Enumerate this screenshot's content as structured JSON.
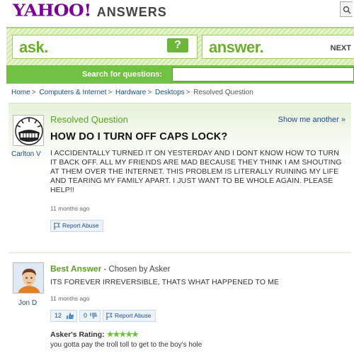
{
  "header": {
    "logo_yahoo": "YAHOO!",
    "logo_answers": "ANSWERS"
  },
  "band": {
    "ask_label": "ask.",
    "ask_button": "?",
    "answer_label": "answer.",
    "next_label": "NEXT",
    "search_label": "Search for questions:",
    "search_value": ""
  },
  "breadcrumb": {
    "items": [
      "Home",
      "Computers & Internet",
      "Hardware",
      "Desktops"
    ],
    "current": "Resolved Question",
    "separator": ">"
  },
  "question": {
    "status": "Resolved Question",
    "show_another": "Show me another »",
    "user": "Carlton V",
    "title": "HOW DO I TURN OFF CAPS LOCK?",
    "body": "I ACCIDENTALLY TURNED IT ON YESTERDAY AND I DONT KNOW HOW TO TURN IT BACK OFF. ALL MY FRIENDS ARE MAD BECAUSE THEY THINK I AM SHOUTING AT THEM OVER THE INTERNET. THIS PROBLEM IS LITERALLY RUINING MY LIFE AND TEARING MY FAMILY APART. I JUST WANT TO BE WHOLE AGAIN. PLEASE HELP!!",
    "time": "11 months ago",
    "report_label": "Report Abuse"
  },
  "answer": {
    "title": "Best Answer",
    "chosen_by": " - Chosen by Asker",
    "user": "Jon D",
    "body": "ITS FOREVER IRREVERSIBLE, THATS WHAT HAPPENED TO ME",
    "time": "11 months ago",
    "thumbs_up": "12",
    "thumbs_down": "0",
    "report_label": "Report Abuse",
    "rating_label": "Asker's Rating:",
    "rating_stars": "★★★★★",
    "comment": "you gotta pay the troll toll to get to the boy's hole"
  },
  "colors": {
    "brand_purple": "#7b0099",
    "accent_green": "#6cae2b",
    "link_blue": "#1a4a96"
  }
}
